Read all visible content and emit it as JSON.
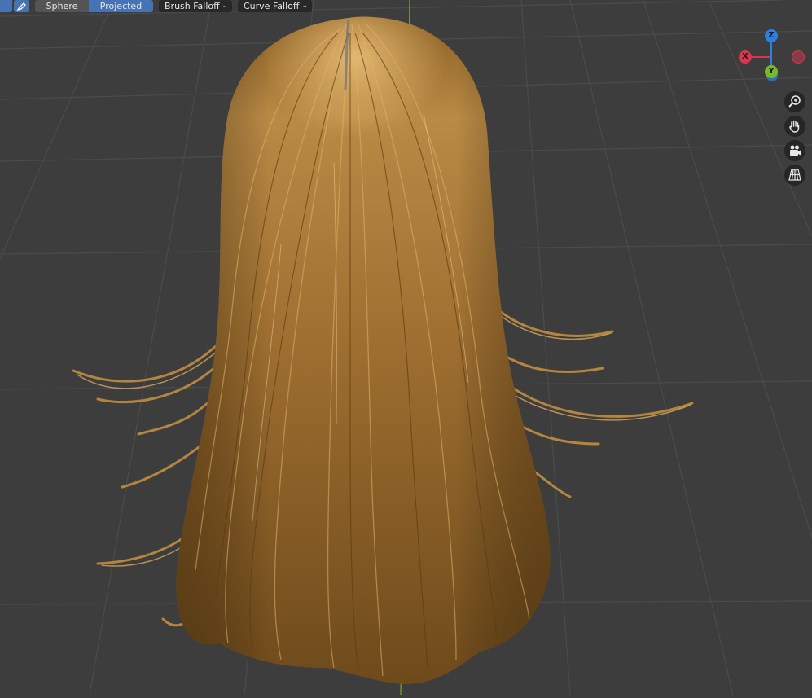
{
  "header": {
    "falloff_shape_options": [
      "Sphere",
      "Projected"
    ],
    "falloff_shape_selected": "Projected",
    "brush_falloff_label": "Brush Falloff",
    "curve_falloff_label": "Curve Falloff"
  },
  "gizmo": {
    "z_label": "Z",
    "x_label": "X",
    "y_label": "Y",
    "colors": {
      "x": "#d8374e",
      "y": "#79b928",
      "z": "#2f7fe0"
    }
  },
  "nav_tools": [
    {
      "icon": "zoom-icon"
    },
    {
      "icon": "pan-hand-icon"
    },
    {
      "icon": "camera-icon"
    },
    {
      "icon": "perspective-grid-icon"
    }
  ],
  "viewport": {
    "background_color": "#3d3d3d",
    "object_color": "#a8782f"
  }
}
